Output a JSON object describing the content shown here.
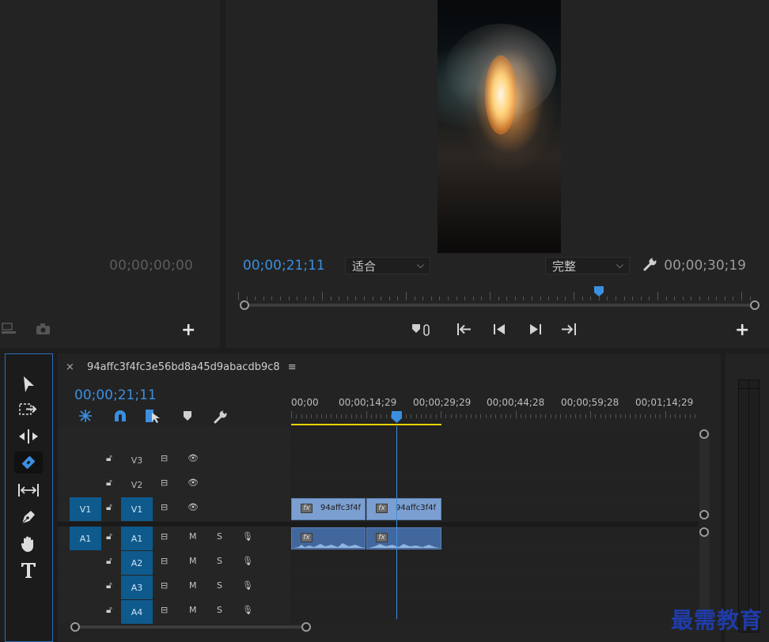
{
  "source_monitor": {
    "timecode": "00;00;00;00"
  },
  "program_monitor": {
    "timecode_current": "00;00;21;11",
    "zoom": "适合",
    "quality": "完整",
    "timecode_duration": "00;00;30;19"
  },
  "timeline": {
    "sequence_name": "94affc3f4fc3e56bd8a45d9abacdb9c8",
    "timecode": "00;00;21;11",
    "ruler_labels": [
      "00;00",
      "00;00;14;29",
      "00;00;29;29",
      "00;00;44;28",
      "00;00;59;28",
      "00;01;14;29"
    ],
    "video_tracks": [
      {
        "name": "V3",
        "source": "",
        "targeted": false
      },
      {
        "name": "V2",
        "source": "",
        "targeted": false
      },
      {
        "name": "V1",
        "source": "V1",
        "targeted": true
      }
    ],
    "audio_tracks": [
      {
        "name": "A1",
        "source": "A1",
        "mute": "M",
        "solo": "S"
      },
      {
        "name": "A2",
        "source": "",
        "mute": "M",
        "solo": "S"
      },
      {
        "name": "A3",
        "source": "",
        "mute": "M",
        "solo": "S"
      },
      {
        "name": "A4",
        "source": "",
        "mute": "M",
        "solo": "S"
      }
    ],
    "clips": [
      {
        "track": "V1",
        "label": "94affc3f4f"
      },
      {
        "track": "V1",
        "label": "94affc3f4f"
      }
    ],
    "fx_label": "fx"
  },
  "watermark": "最需教育",
  "colors": {
    "accent_blue": "#3b8fe0",
    "target_blue": "#0f5a8c",
    "clip_video": "#7c9fd1",
    "clip_audio": "#41679d",
    "work_area": "#e9d300",
    "watermark": "#1f3ca8"
  }
}
